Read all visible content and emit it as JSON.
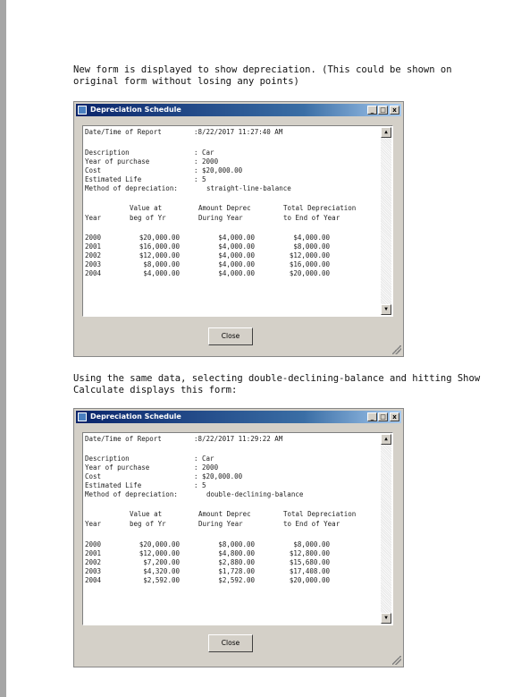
{
  "paragraphs": {
    "intro": "New form is displayed to show depreciation. (This could be shown on original form without losing any points)",
    "second": "Using the same data, selecting double-declining-balance and hitting Show Calculate displays this form:"
  },
  "windows": [
    {
      "title": "Depreciation Schedule",
      "controls": {
        "minimize": "_",
        "maximize": "□",
        "close": "x"
      },
      "report": {
        "datetime_label": "Date/Time of Report",
        "datetime_value": ":8/22/2017 11:27:40 AM",
        "fields": [
          {
            "label": "Description",
            "value": ": Car"
          },
          {
            "label": "Year of purchase",
            "value": ": 2000"
          },
          {
            "label": "Cost",
            "value": ": $20,000.00"
          },
          {
            "label": "Estimated Life",
            "value": ": 5"
          }
        ],
        "method_label": "Method of depreciation:",
        "method_value": "straight-line-balance",
        "headers": {
          "year": "Year",
          "value_top": "Value at",
          "value_bottom": "beg of Yr",
          "amount_top": "Amount Deprec",
          "amount_bottom": "During Year",
          "total_top": "Total Depreciation",
          "total_bottom": "to End of Year"
        },
        "rows": [
          {
            "year": "2000",
            "value": "$20,000.00",
            "amount": "$4,000.00",
            "total": "$4,000.00"
          },
          {
            "year": "2001",
            "value": "$16,000.00",
            "amount": "$4,000.00",
            "total": "$8,000.00"
          },
          {
            "year": "2002",
            "value": "$12,000.00",
            "amount": "$4,000.00",
            "total": "$12,000.00"
          },
          {
            "year": "2003",
            "value": "$8,000.00",
            "amount": "$4,000.00",
            "total": "$16,000.00"
          },
          {
            "year": "2004",
            "value": "$4,000.00",
            "amount": "$4,000.00",
            "total": "$20,000.00"
          }
        ]
      },
      "close_label": "Close"
    },
    {
      "title": "Depreciation Schedule",
      "controls": {
        "minimize": "_",
        "maximize": "□",
        "close": "x"
      },
      "report": {
        "datetime_label": "Date/Time of Report",
        "datetime_value": ":8/22/2017 11:29:22 AM",
        "fields": [
          {
            "label": "Description",
            "value": ": Car"
          },
          {
            "label": "Year of purchase",
            "value": ": 2000"
          },
          {
            "label": "Cost",
            "value": ": $20,000.00"
          },
          {
            "label": "Estimated Life",
            "value": ": 5"
          }
        ],
        "method_label": "Method of depreciation:",
        "method_value": "double-declining-balance",
        "headers": {
          "year": "Year",
          "value_top": "Value at",
          "value_bottom": "beg of Yr",
          "amount_top": "Amount Deprec",
          "amount_bottom": "During Year",
          "total_top": "Total Depreciation",
          "total_bottom": "to End of Year"
        },
        "rows": [
          {
            "year": "2000",
            "value": "$20,000.00",
            "amount": "$8,000.00",
            "total": "$8,000.00"
          },
          {
            "year": "2001",
            "value": "$12,000.00",
            "amount": "$4,800.00",
            "total": "$12,800.00"
          },
          {
            "year": "2002",
            "value": "$7,200.00",
            "amount": "$2,880.00",
            "total": "$15,680.00"
          },
          {
            "year": "2003",
            "value": "$4,320.00",
            "amount": "$1,728.00",
            "total": "$17,408.00"
          },
          {
            "year": "2004",
            "value": "$2,592.00",
            "amount": "$2,592.00",
            "total": "$20,000.00"
          }
        ]
      },
      "close_label": "Close"
    }
  ]
}
